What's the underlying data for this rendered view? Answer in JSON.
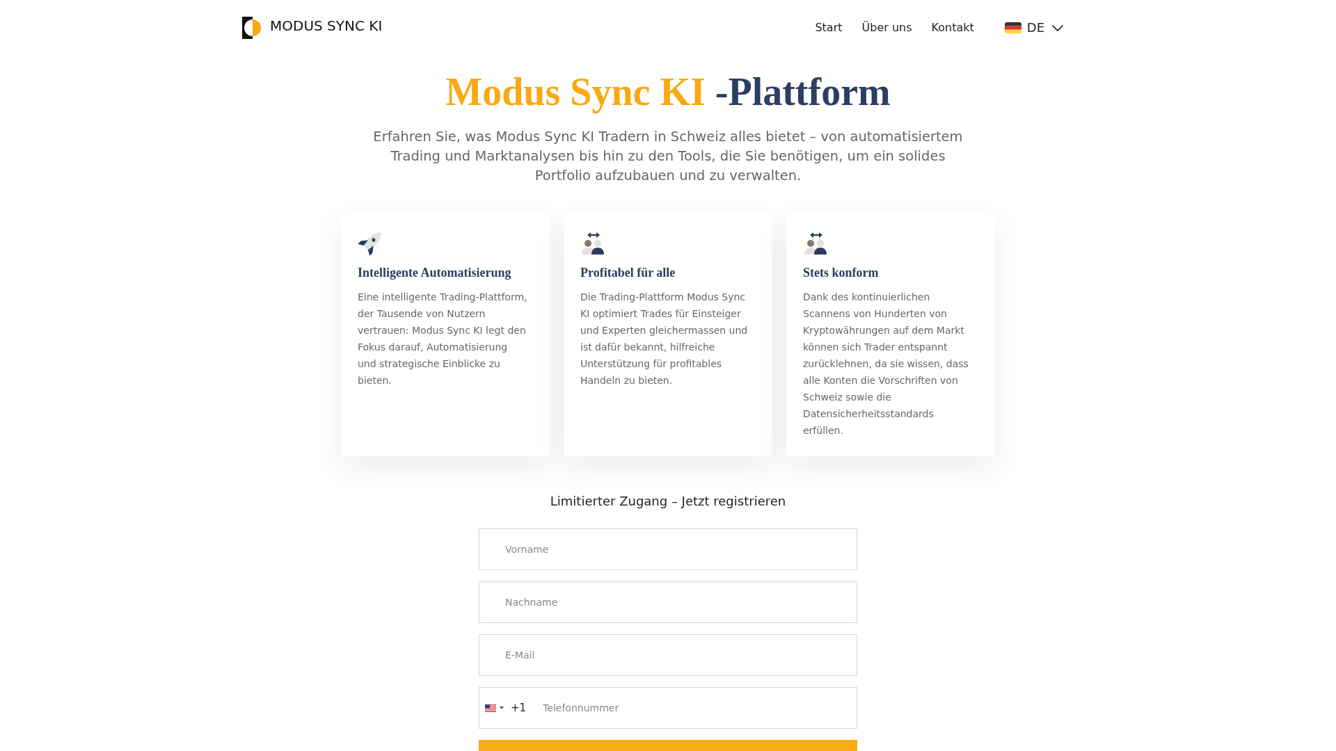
{
  "header": {
    "brand": "MODUS SYNC KI",
    "nav": [
      {
        "label": "Start"
      },
      {
        "label": "Über uns"
      },
      {
        "label": "Kontakt"
      }
    ],
    "language": "DE"
  },
  "hero": {
    "title": {
      "brand": "Modus Sync KI",
      "suffix": "-Plattform"
    },
    "subtitle": "Erfahren Sie, was Modus Sync KI Tradern in Schweiz alles bietet – von automatisiertem Trading und Marktanalysen bis hin zu den Tools, die Sie benötigen, um ein solides Portfolio aufzubauen und zu verwalten."
  },
  "features": [
    {
      "kind": "rocket",
      "title": "Intelligente Automatisierung",
      "text": "Eine intelligente Trading-Plattform, der Tausende von Nutzern vertrauen: Modus Sync KI legt den Fokus darauf, Automatisierung und strategische Einblicke zu bieten."
    },
    {
      "kind": "exchange",
      "title": "Profitabel für alle",
      "text": "Die Trading-Plattform Modus Sync KI optimiert Trades für Einsteiger und Experten gleichermassen und ist dafür bekannt, hilfreiche Unterstützung für profitables Handeln zu bieten."
    },
    {
      "kind": "exchange",
      "title": "Stets konform",
      "text": "Dank des kontinuierlichen Scannens von Hunderten von Kryptowährungen auf dem Markt können sich Trader entspannt zurücklehnen, da sie wissen, dass alle Konten die Vorschriften von Schweiz sowie die Datensicherheitsstandards erfüllen."
    }
  ],
  "signup": {
    "title": "Limitierter Zugang – Jetzt registrieren",
    "fields": [
      {
        "placeholder": "Vorname"
      },
      {
        "placeholder": "Nachname"
      },
      {
        "placeholder": "E-Mail"
      }
    ],
    "phone": {
      "dial_code": "+1",
      "placeholder": "Telefonnummer"
    }
  }
}
